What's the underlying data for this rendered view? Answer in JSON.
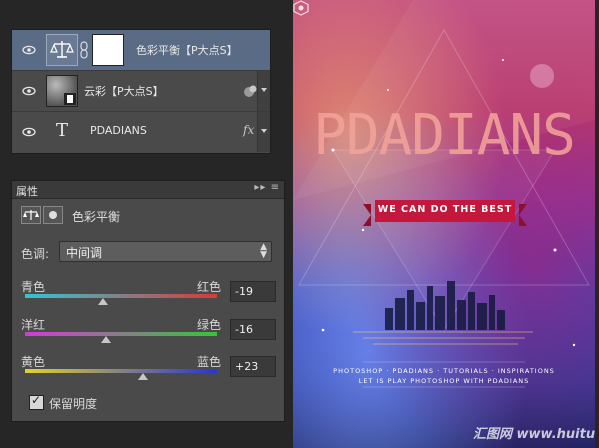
{
  "layers": [
    {
      "name": "色彩平衡【P大点S】",
      "type": "adjustment",
      "selected": true
    },
    {
      "name": "云彩【P大点S】",
      "type": "image",
      "selected": false
    },
    {
      "name": "PDADIANS",
      "type": "text",
      "thumb_glyph": "T",
      "selected": false,
      "fx": "fx"
    }
  ],
  "properties": {
    "tab_label": "属性",
    "menu_glyph": "▸▸ ≡",
    "title": "色彩平衡",
    "tone": {
      "label": "色调:",
      "value": "中间调"
    },
    "sliders": [
      {
        "left": "青色",
        "right": "红色",
        "value": "-19",
        "colors": [
          "#2fc6d6",
          "#d83a3a"
        ],
        "level": -19
      },
      {
        "left": "洋红",
        "right": "绿色",
        "value": "-16",
        "colors": [
          "#d23bd6",
          "#38c43a"
        ],
        "level": -16
      },
      {
        "left": "黄色",
        "right": "蓝色",
        "value": "+23",
        "colors": [
          "#e2d22a",
          "#2a33d8"
        ],
        "level": 23
      }
    ],
    "preserve_luminosity": {
      "label": "保留明度",
      "checked": true
    }
  },
  "poster": {
    "title": "PDADIANS",
    "ribbon": "WE CAN DO THE BEST",
    "line1": "PHOTOSHOP · PDADIANS · TUTORIALS · INSPIRATIONS",
    "line2": "LET IS PLAY PHOTOSHOP WITH PDADIANS",
    "watermark": "汇图网 www.huitu.com"
  }
}
